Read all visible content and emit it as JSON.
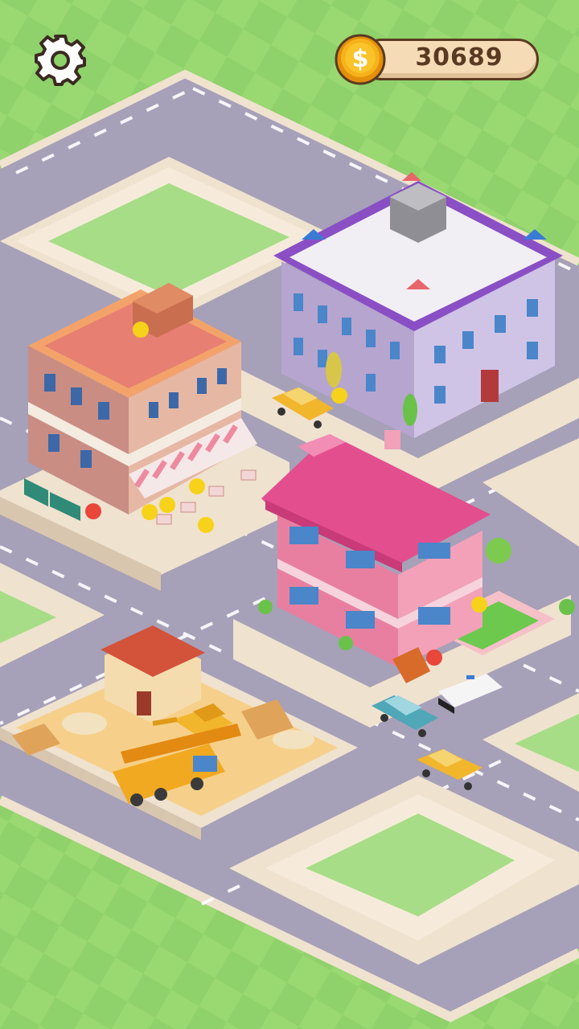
{
  "hud": {
    "coins": "30689",
    "coin_symbol": "$",
    "settings_icon": "gear-icon"
  },
  "scene": {
    "buildings": [
      "restaurant",
      "hotel",
      "pink-house",
      "construction-site"
    ],
    "vehicles": [
      "taxi",
      "taxi",
      "police-car",
      "blue-car",
      "crane-truck",
      "excavator"
    ]
  },
  "colors": {
    "grass": "#8fd16a",
    "road": "#a39bb5",
    "coin_gold": "#f6b21a",
    "hud_text": "#5a3a22"
  }
}
